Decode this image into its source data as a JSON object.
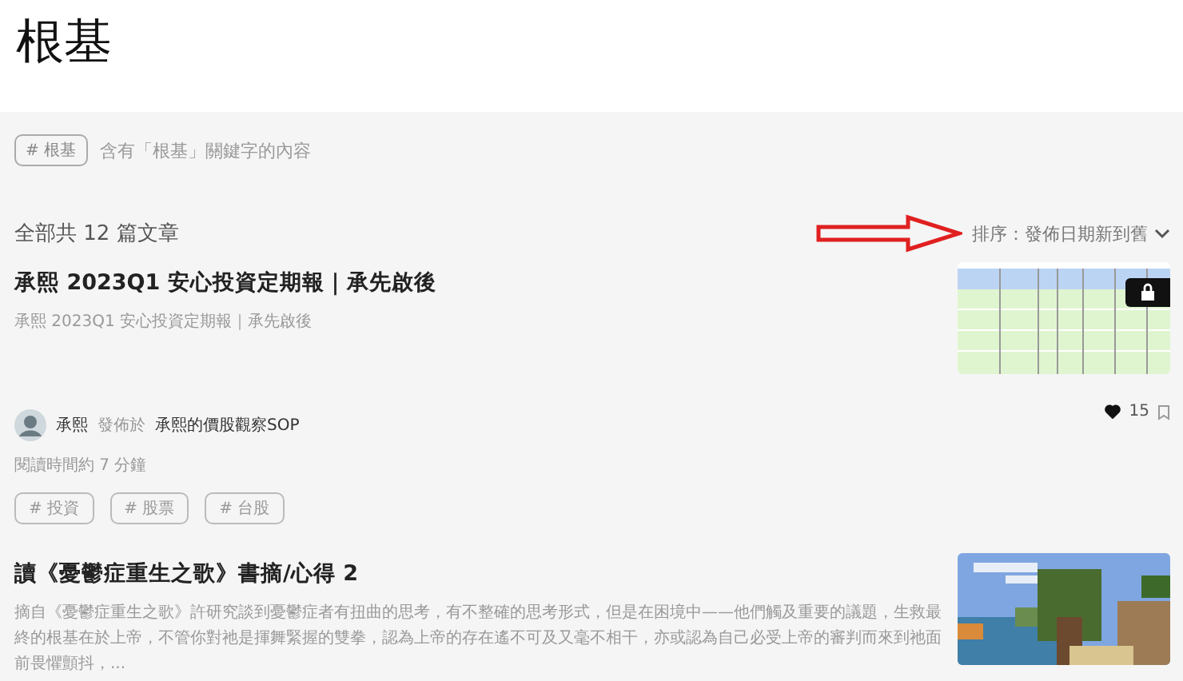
{
  "page_title": "根基",
  "keyword": {
    "tag": "# 根基",
    "description": "含有「根基」關鍵字的內容"
  },
  "count": "全部共 12 篇文章",
  "sort": {
    "label": "排序：發佈日期新到舊",
    "annotated": true
  },
  "articles": [
    {
      "title": "承熙 2023Q1 安心投資定期報｜承先啟後",
      "excerpt": "承熙 2023Q1 安心投資定期報｜承先啟後",
      "locked": true,
      "author": "承熙",
      "published_label": "發佈於",
      "publication": "承熙的價股觀察SOP",
      "read_time": "閱讀時間約 7 分鐘",
      "likes": "15",
      "liked": true,
      "bookmarked": false,
      "tags": [
        "# 投資",
        "# 股票",
        "# 台股"
      ]
    },
    {
      "title": "讀《憂鬱症重生之歌》書摘/心得 2",
      "excerpt": "摘自《憂鬱症重生之歌》許研究談到憂鬱症者有扭曲的思考，有不整確的思考形式，但是在困境中——他們觸及重要的議題，生救最終的根基在於上帝，不管你對祂是揮舞緊握的雙拳，認為上帝的存在遙不可及又毫不相干，亦或認為自己必受上帝的審判而來到祂面前畏懼顫抖，..."
    }
  ]
}
